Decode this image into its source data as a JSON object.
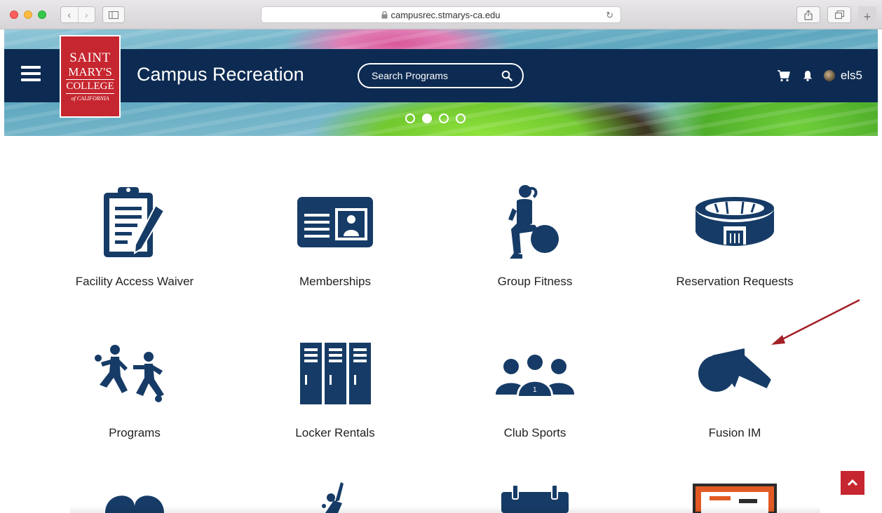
{
  "browser": {
    "url": "campusrec.stmarys-ca.edu",
    "back_glyph": "‹",
    "forward_glyph": "›",
    "new_tab_glyph": "+",
    "reload_glyph": "↻"
  },
  "header": {
    "logo": {
      "line1": "SAINT",
      "line2": "MARY'S",
      "line3": "COLLEGE",
      "line4": "of CALIFORNIA"
    },
    "title": "Campus Recreation",
    "search": {
      "placeholder": "Search Programs"
    },
    "username": "els5",
    "icons": [
      "hamburger-menu-icon",
      "search-icon",
      "cart-icon",
      "bell-icon"
    ],
    "colors": {
      "nav_band": "#0d2b52",
      "brand_red": "#c6262f"
    }
  },
  "carousel": {
    "dot_count": 4,
    "active_index": 1
  },
  "tiles": [
    {
      "label": "Facility Access Waiver",
      "icon": "clipboard-pen-icon"
    },
    {
      "label": "Memberships",
      "icon": "id-card-icon"
    },
    {
      "label": "Group Fitness",
      "icon": "fitness-ball-icon"
    },
    {
      "label": "Reservation Requests",
      "icon": "stadium-icon"
    },
    {
      "label": "Programs",
      "icon": "soccer-players-icon"
    },
    {
      "label": "Locker Rentals",
      "icon": "lockers-icon"
    },
    {
      "label": "Club Sports",
      "icon": "team-icon"
    },
    {
      "label": "Fusion IM",
      "icon": "whistle-icon"
    }
  ],
  "annotation": {
    "arrow_color": "#a32027"
  },
  "icon_color": "#163b66"
}
